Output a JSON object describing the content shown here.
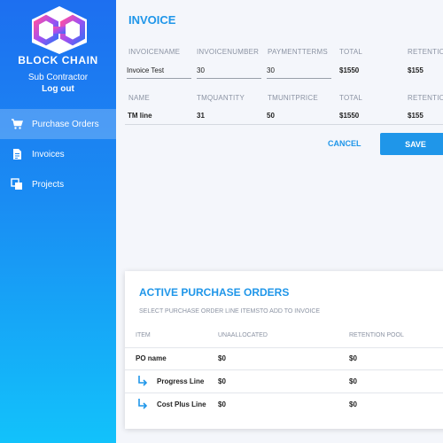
{
  "sidebar": {
    "brand": "BLOCK CHAIN",
    "role": "Sub Contractor",
    "logout": "Log out",
    "items": [
      {
        "label": "Purchase Orders",
        "icon": "cart-icon",
        "active": true
      },
      {
        "label": "Invoices",
        "icon": "document-icon",
        "active": false
      },
      {
        "label": "Projects",
        "icon": "copy-squares-icon",
        "active": false
      }
    ]
  },
  "invoice": {
    "title": "INVOICE",
    "header_row": {
      "labels": [
        "INVOICENAME",
        "INVOICENUMBER",
        "PAYMENTTERMS",
        "TOTAL",
        "RETENTION"
      ],
      "values": [
        "Invoice Test",
        "30",
        "30",
        "$1550",
        "$155"
      ]
    },
    "line_row": {
      "labels": [
        "NAME",
        "TMQUANTITY",
        "TMUNITPRICE",
        "TOTAL",
        "RETENTION"
      ],
      "values": [
        "TM line",
        "31",
        "50",
        "$1550",
        "$155"
      ]
    },
    "cancel_label": "CANCEL",
    "save_label": "SAVE"
  },
  "active_orders": {
    "title": "ACTIVE PURCHASE ORDERS",
    "subtitle": "SELECT PURCHASE ORDER LINE ITEMSTO ADD TO INVOICE",
    "columns": [
      "ITEM",
      "UNAALLOCATED",
      "RETENTION POOL"
    ],
    "rows": [
      {
        "item": "PO name",
        "unallocated": "$0",
        "retention_pool": "$0"
      },
      {
        "item": "Progress Line",
        "unallocated": "$0",
        "retention_pool": "$0"
      },
      {
        "item": "Cost Plus Line",
        "unallocated": "$0",
        "retention_pool": "$0"
      }
    ]
  },
  "colors": {
    "accent": "#1f96e9",
    "sidebar_top": "#1d6ff0",
    "sidebar_bottom": "#12c2fb"
  }
}
